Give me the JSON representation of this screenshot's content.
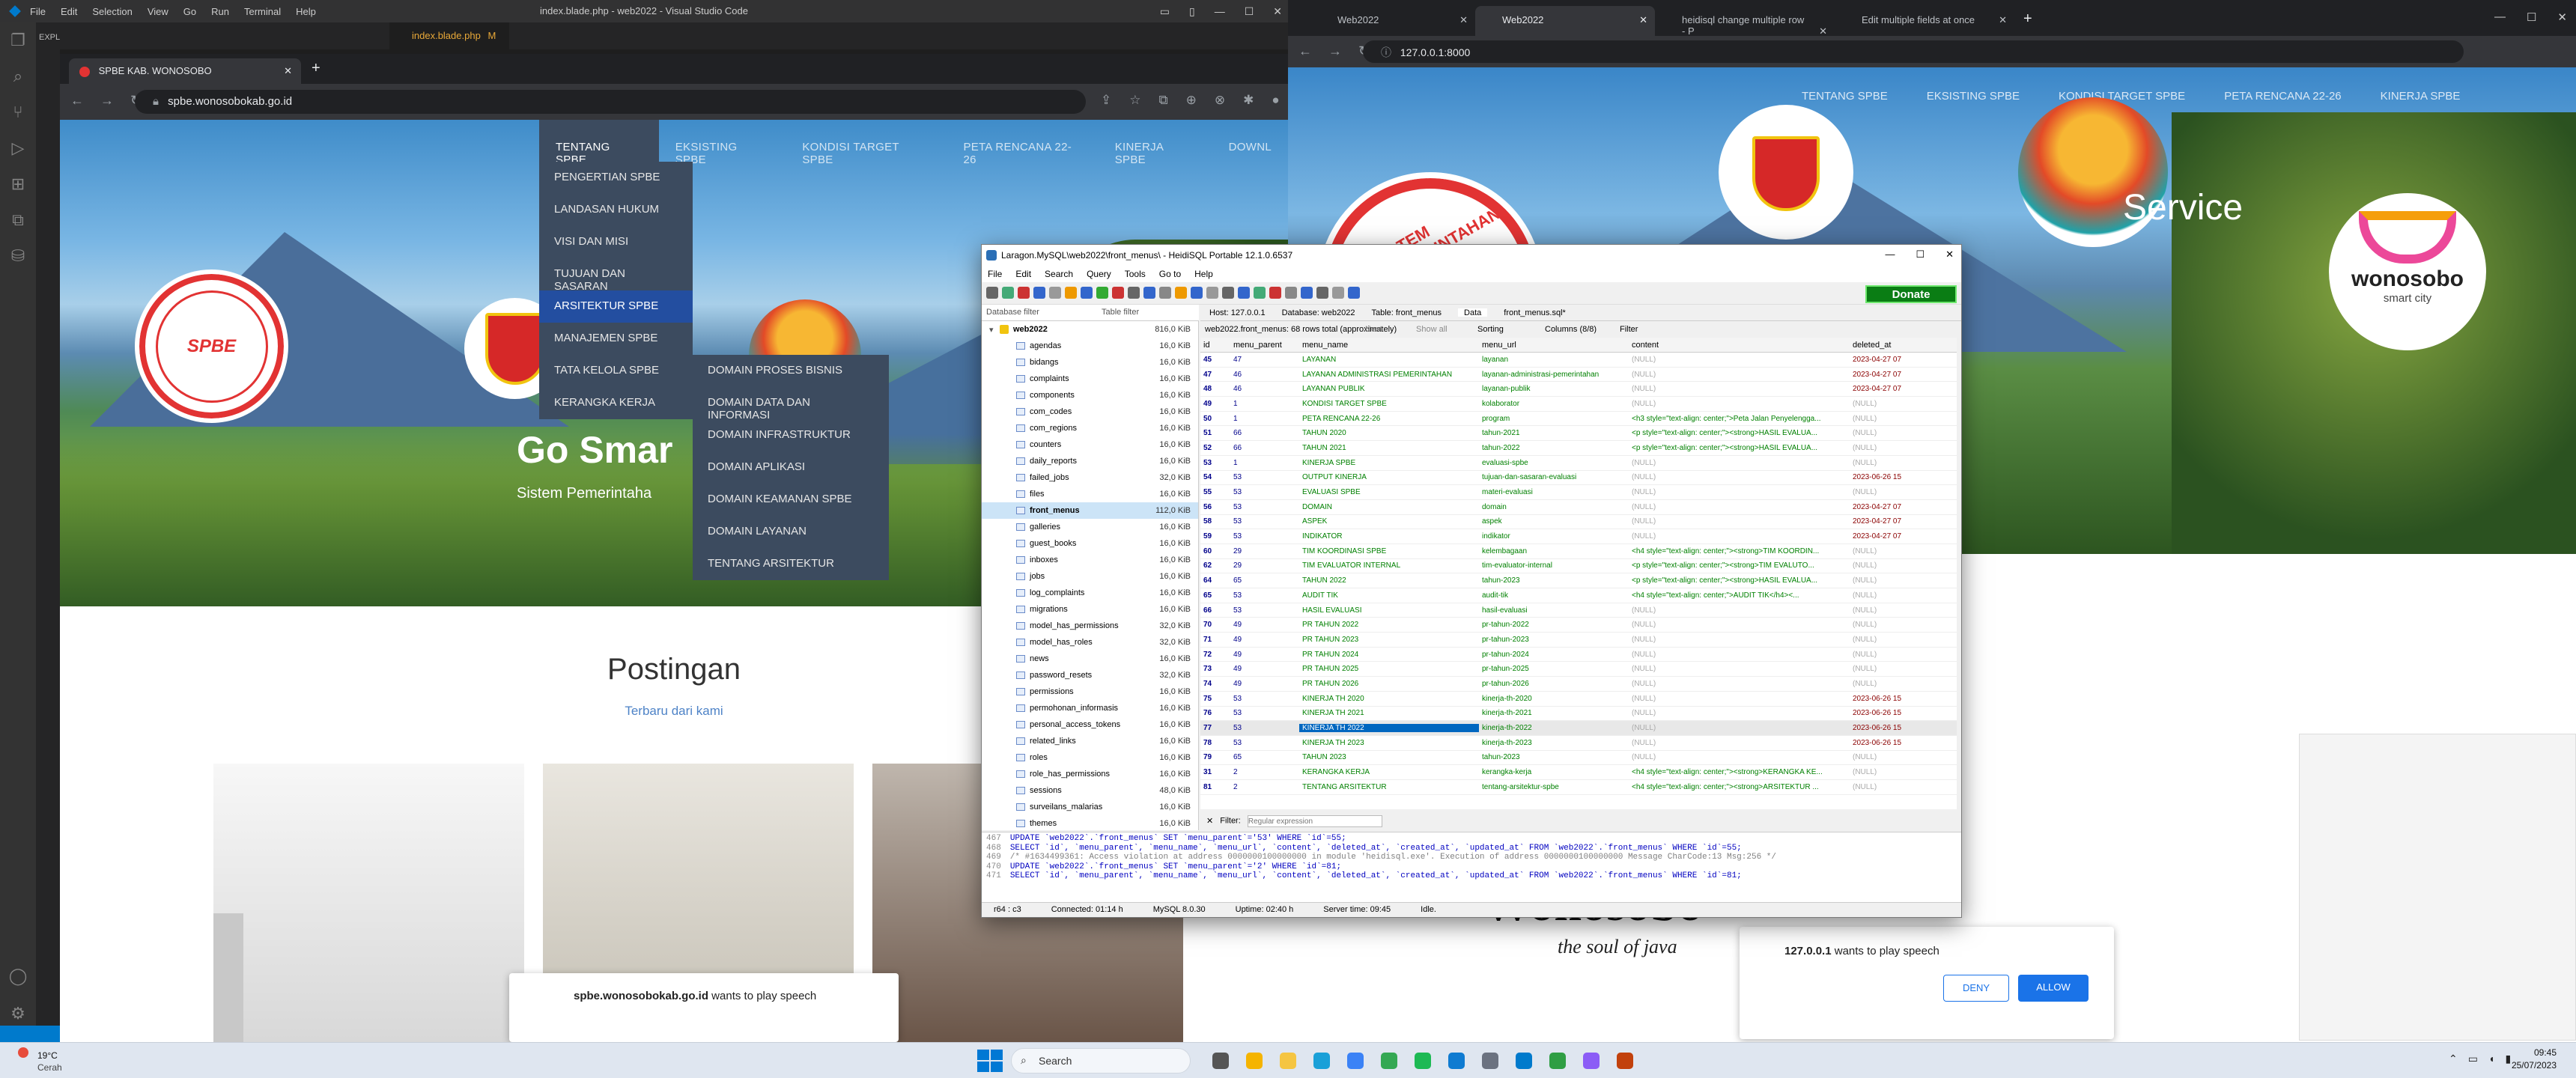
{
  "vscode": {
    "menu": [
      "File",
      "Edit",
      "Selection",
      "View",
      "Go",
      "Run",
      "Terminal",
      "Help"
    ],
    "title": "index.blade.php - web2022 - Visual Studio Code",
    "explorer_label": "EXPLORER",
    "tab_label": "index.blade.php",
    "tab_modified": "M"
  },
  "left_browser": {
    "tab_title": "SPBE KAB. WONOSOBO",
    "url": "spbe.wonosobokab.go.id",
    "nav": [
      "TENTANG SPBE",
      "EKSISTING SPBE",
      "KONDISI TARGET SPBE",
      "PETA RENCANA 22-26",
      "KINERJA SPBE",
      "DOWNL"
    ],
    "dropdown": [
      "PENGERTIAN SPBE",
      "LANDASAN HUKUM",
      "VISI DAN MISI",
      "TUJUAN DAN SASARAN",
      "ARSITEKTUR SPBE",
      "MANAJEMEN SPBE",
      "TATA KELOLA SPBE",
      "KERANGKA KERJA"
    ],
    "submenu": [
      "DOMAIN PROSES BISNIS",
      "DOMAIN DATA DAN INFORMASI",
      "DOMAIN INFRASTRUKTUR",
      "DOMAIN APLIKASI",
      "DOMAIN KEAMANAN SPBE",
      "DOMAIN LAYANAN",
      "TENTANG ARSITEKTUR"
    ],
    "hero_title": "Go Smar",
    "hero_sub": "Sistem Pemerintaha",
    "seal_text": "SISTEM PEMERINTAHAN BERBASIS ELEKTRONIK",
    "seal_center": "SPBE",
    "section_title": "Postingan",
    "section_sub": "Terbaru dari kami",
    "speech_host": "spbe.wonosobokab.go.id",
    "speech_text": "wants to play speech"
  },
  "right_browser": {
    "tabs": [
      "Web2022",
      "Web2022",
      "heidisql change multiple row - P",
      "Edit multiple fields at once"
    ],
    "url": "127.0.0.1:8000",
    "nav": [
      "TENTANG SPBE",
      "EKSISTING SPBE",
      "KONDISI TARGET SPBE",
      "PETA RENCANA 22-26",
      "KINERJA SPBE"
    ],
    "hero_word": "Service",
    "logo_text": "wonosobo",
    "logo_sub": "smart city",
    "seal_text": "SISTEM PEMERINTAHAN",
    "bottom_big": "Wonosobo",
    "bottom_tag": "the soul of java",
    "speech_host": "127.0.0.1",
    "speech_text": "wants to play speech",
    "deny": "DENY",
    "allow": "ALLOW"
  },
  "heidisql": {
    "title": "Laragon.MySQL\\web2022\\front_menus\\ - HeidiSQL Portable 12.1.0.6537",
    "menu": [
      "File",
      "Edit",
      "Search",
      "Query",
      "Tools",
      "Go to",
      "Help"
    ],
    "donate": "Donate",
    "db_filter": "Database filter",
    "table_filter": "Table filter",
    "tabs": [
      "Host: 127.0.0.1",
      "Database: web2022",
      "Table: front_menus",
      "Data",
      "front_menus.sql*"
    ],
    "info": "web2022.front_menus: 68 rows total (approximately)",
    "next": "Next",
    "show_all": "Show all",
    "sorting": "Sorting",
    "columns_btn": "Columns (8/8)",
    "filter_btn": "Filter",
    "db_name": "web2022",
    "db_size": "816,0 KiB",
    "tables": [
      {
        "n": "agendas",
        "s": "16,0 KiB"
      },
      {
        "n": "bidangs",
        "s": "16,0 KiB"
      },
      {
        "n": "complaints",
        "s": "16,0 KiB"
      },
      {
        "n": "components",
        "s": "16,0 KiB"
      },
      {
        "n": "com_codes",
        "s": "16,0 KiB"
      },
      {
        "n": "com_regions",
        "s": "16,0 KiB"
      },
      {
        "n": "counters",
        "s": "16,0 KiB"
      },
      {
        "n": "daily_reports",
        "s": "16,0 KiB"
      },
      {
        "n": "failed_jobs",
        "s": "32,0 KiB"
      },
      {
        "n": "files",
        "s": "16,0 KiB"
      },
      {
        "n": "front_menus",
        "s": "112,0 KiB"
      },
      {
        "n": "galleries",
        "s": "16,0 KiB"
      },
      {
        "n": "guest_books",
        "s": "16,0 KiB"
      },
      {
        "n": "inboxes",
        "s": "16,0 KiB"
      },
      {
        "n": "jobs",
        "s": "16,0 KiB"
      },
      {
        "n": "log_complaints",
        "s": "16,0 KiB"
      },
      {
        "n": "migrations",
        "s": "16,0 KiB"
      },
      {
        "n": "model_has_permissions",
        "s": "32,0 KiB"
      },
      {
        "n": "model_has_roles",
        "s": "32,0 KiB"
      },
      {
        "n": "news",
        "s": "16,0 KiB"
      },
      {
        "n": "password_resets",
        "s": "32,0 KiB"
      },
      {
        "n": "permissions",
        "s": "16,0 KiB"
      },
      {
        "n": "permohonan_informasis",
        "s": "16,0 KiB"
      },
      {
        "n": "personal_access_tokens",
        "s": "16,0 KiB"
      },
      {
        "n": "related_links",
        "s": "16,0 KiB"
      },
      {
        "n": "roles",
        "s": "16,0 KiB"
      },
      {
        "n": "role_has_permissions",
        "s": "16,0 KiB"
      },
      {
        "n": "sessions",
        "s": "48,0 KiB"
      },
      {
        "n": "surveilans_malarias",
        "s": "16,0 KiB"
      },
      {
        "n": "themes",
        "s": "16,0 KiB"
      }
    ],
    "columns": [
      "id",
      "menu_parent",
      "menu_name",
      "menu_url",
      "content",
      "deleted_at"
    ],
    "rows": [
      [
        "45",
        "47",
        "LAYANAN",
        "layanan",
        "(NULL)",
        "2023-04-27 07"
      ],
      [
        "47",
        "46",
        "LAYANAN ADMINISTRASI PEMERINTAHAN",
        "layanan-administrasi-pemerintahan",
        "(NULL)",
        "2023-04-27 07"
      ],
      [
        "48",
        "46",
        "LAYANAN PUBLIK",
        "layanan-publik",
        "(NULL)",
        "2023-04-27 07"
      ],
      [
        "49",
        "1",
        "KONDISI TARGET SPBE",
        "kolaborator",
        "(NULL)",
        "(NULL)"
      ],
      [
        "50",
        "1",
        "PETA RENCANA 22-26",
        "program",
        "<h3 style=\"text-align: center;\">Peta Jalan Penyelengga...",
        "(NULL)"
      ],
      [
        "51",
        "66",
        "TAHUN 2020",
        "tahun-2021",
        "<p style=\"text-align: center;\"><strong>HASIL EVALUA...",
        "(NULL)"
      ],
      [
        "52",
        "66",
        "TAHUN 2021",
        "tahun-2022",
        "<p style=\"text-align: center;\"><strong>HASIL EVALUA...",
        "(NULL)"
      ],
      [
        "53",
        "1",
        "KINERJA SPBE",
        "evaluasi-spbe",
        "(NULL)",
        "(NULL)"
      ],
      [
        "54",
        "53",
        "OUTPUT KINERJA",
        "tujuan-dan-sasaran-evaluasi",
        "(NULL)",
        "2023-06-26 15"
      ],
      [
        "55",
        "53",
        "EVALUASI SPBE",
        "materi-evaluasi",
        "(NULL)",
        "(NULL)"
      ],
      [
        "56",
        "53",
        "DOMAIN",
        "domain",
        "(NULL)",
        "2023-04-27 07"
      ],
      [
        "58",
        "53",
        "ASPEK",
        "aspek",
        "(NULL)",
        "2023-04-27 07"
      ],
      [
        "59",
        "53",
        "INDIKATOR",
        "indikator",
        "(NULL)",
        "2023-04-27 07"
      ],
      [
        "60",
        "29",
        "TIM KOORDINASI SPBE",
        "kelembagaan",
        "<h4 style=\"text-align: center;\"><strong>TIM KOORDIN...",
        "(NULL)"
      ],
      [
        "62",
        "29",
        "TIM EVALUATOR INTERNAL",
        "tim-evaluator-internal",
        "<p style=\"text-align: center;\"><strong>TIM EVALUTO...",
        "(NULL)"
      ],
      [
        "64",
        "65",
        "TAHUN 2022",
        "tahun-2023",
        "<p style=\"text-align: center;\"><strong>HASIL EVALUA...",
        "(NULL)"
      ],
      [
        "65",
        "53",
        "AUDIT TIK",
        "audit-tik",
        "<h4 style=\"text-align: center;\">AUDIT TIK</h4><...",
        "(NULL)"
      ],
      [
        "66",
        "53",
        "HASIL EVALUASI",
        "hasil-evaluasi",
        "(NULL)",
        "(NULL)"
      ],
      [
        "70",
        "49",
        "PR TAHUN 2022",
        "pr-tahun-2022",
        "(NULL)",
        "(NULL)"
      ],
      [
        "71",
        "49",
        "PR TAHUN 2023",
        "pr-tahun-2023",
        "(NULL)",
        "(NULL)"
      ],
      [
        "72",
        "49",
        "PR TAHUN 2024",
        "pr-tahun-2024",
        "(NULL)",
        "(NULL)"
      ],
      [
        "73",
        "49",
        "PR TAHUN 2025",
        "pr-tahun-2025",
        "(NULL)",
        "(NULL)"
      ],
      [
        "74",
        "49",
        "PR TAHUN 2026",
        "pr-tahun-2026",
        "(NULL)",
        "(NULL)"
      ],
      [
        "75",
        "53",
        "KINERJA TH 2020",
        "kinerja-th-2020",
        "(NULL)",
        "2023-06-26 15"
      ],
      [
        "76",
        "53",
        "KINERJA TH 2021",
        "kinerja-th-2021",
        "(NULL)",
        "2023-06-26 15"
      ],
      [
        "77",
        "53",
        "KINERJA TH 2022",
        "kinerja-th-2022",
        "(NULL)",
        "2023-06-26 15"
      ],
      [
        "78",
        "53",
        "KINERJA TH 2023",
        "kinerja-th-2023",
        "(NULL)",
        "2023-06-26 15"
      ],
      [
        "79",
        "65",
        "TAHUN 2023",
        "tahun-2023",
        "(NULL)",
        "(NULL)"
      ],
      [
        "31",
        "2",
        "KERANGKA KERJA",
        "kerangka-kerja",
        "<h4 style=\"text-align: center;\"><strong>KERANGKA KE...",
        "(NULL)"
      ],
      [
        "81",
        "2",
        "TENTANG ARSITEKTUR",
        "tentang-arsitektur-spbe",
        "<h4 style=\"text-align: center;\"><strong>ARSITEKTUR ...",
        "(NULL)"
      ]
    ],
    "selected_row": 25,
    "filter_label": "Filter:",
    "filter_placeholder": "Regular expression",
    "log": [
      [
        "467",
        "UPDATE `web2022`.`front_menus` SET `menu_parent`='53' WHERE `id`=55;"
      ],
      [
        "468",
        "SELECT `id`, `menu_parent`, `menu_name`, `menu_url`, `content`, `deleted_at`, `created_at`, `updated_at` FROM `web2022`.`front_menus` WHERE `id`=55;"
      ],
      [
        "469",
        "/* #1634499361: Access violation at address 0000000100000000 in module 'heidisql.exe'. Execution of address 0000000100000000 Message CharCode:13 Msg:256 */"
      ],
      [
        "470",
        "UPDATE `web2022`.`front_menus` SET `menu_parent`='2' WHERE `id`=81;"
      ],
      [
        "471",
        "SELECT `id`, `menu_parent`, `menu_name`, `menu_url`, `content`, `deleted_at`, `created_at`, `updated_at` FROM `web2022`.`front_menus` WHERE `id`=81;"
      ]
    ],
    "status": [
      "r64 : c3",
      "Connected: 01:14 h",
      "MySQL 8.0.30",
      "Uptime: 02:40 h",
      "Server time: 09:45",
      "Idle."
    ]
  },
  "taskbar": {
    "weather_temp": "19°C",
    "weather_desc": "Cerah",
    "search": "Search",
    "time": "09:45",
    "date": "25/07/2023"
  }
}
